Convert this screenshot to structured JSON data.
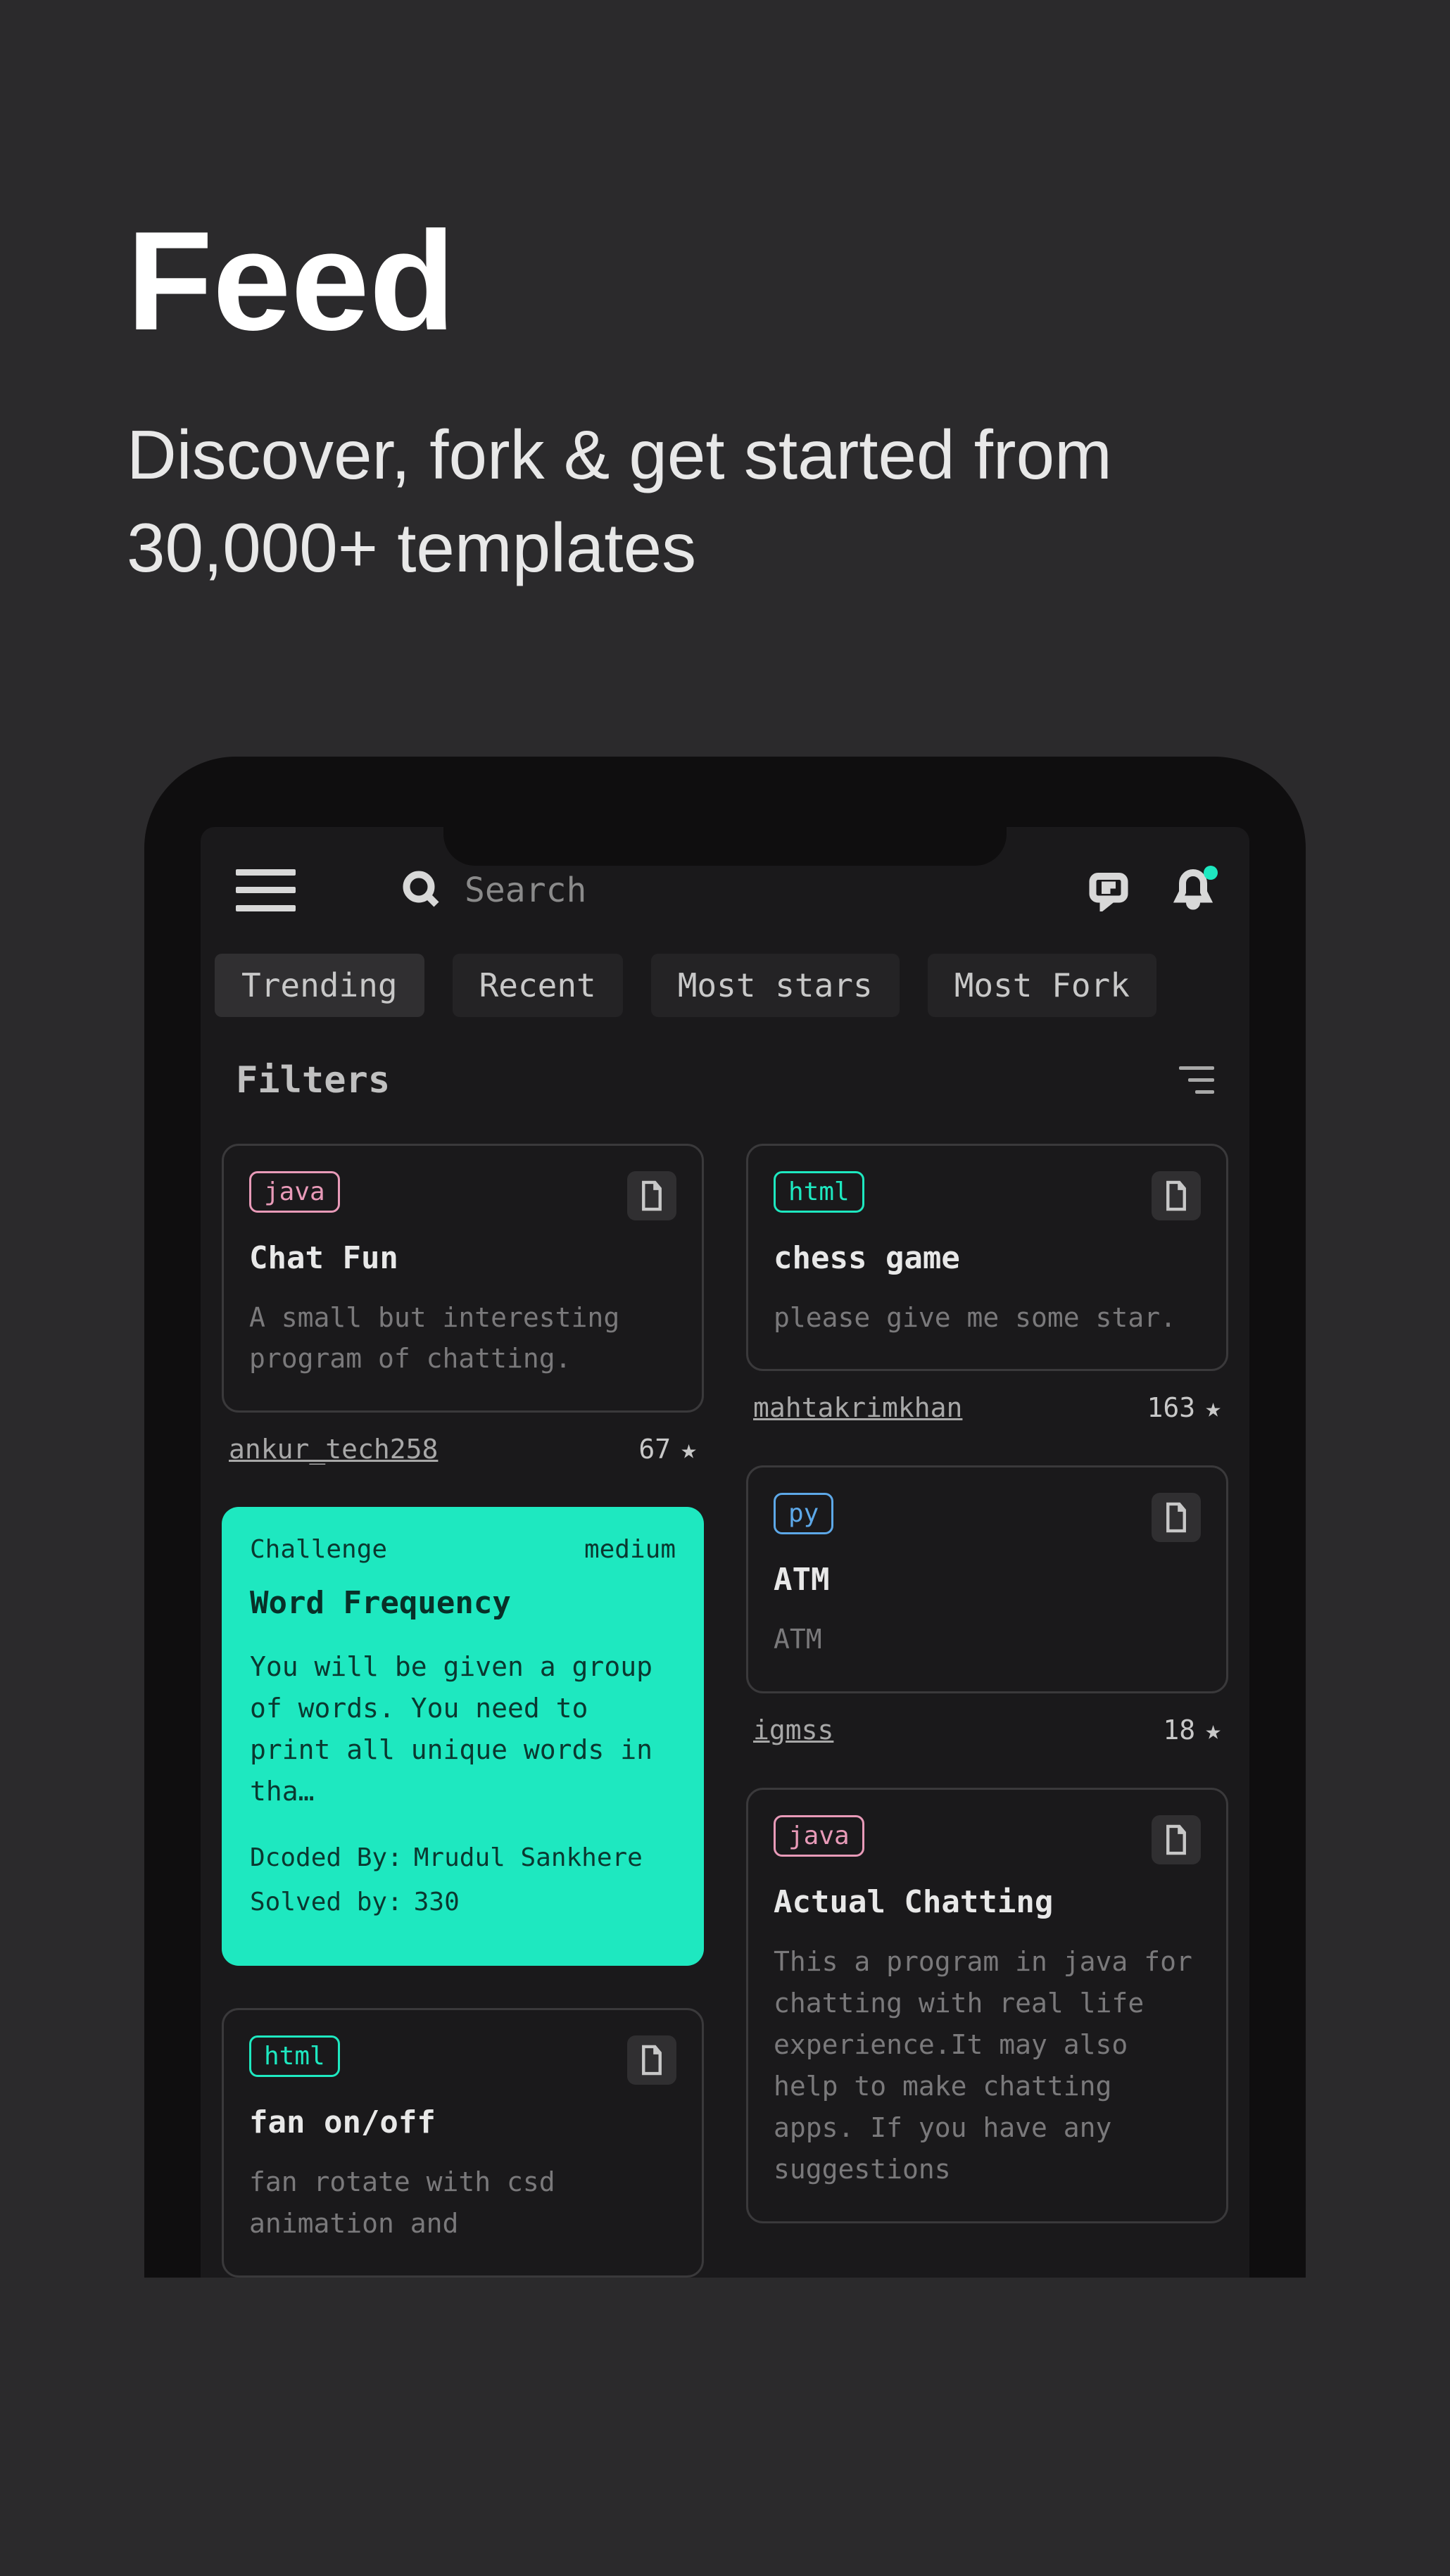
{
  "promo": {
    "title": "Feed",
    "subtitle": "Discover, fork & get started from 30,000+ templates"
  },
  "search": {
    "placeholder": "Search"
  },
  "tabs": [
    {
      "label": "Trending",
      "active": true
    },
    {
      "label": "Recent",
      "active": false
    },
    {
      "label": "Most stars",
      "active": false
    },
    {
      "label": "Most Fork",
      "active": false
    }
  ],
  "filters": {
    "label": "Filters"
  },
  "cards": {
    "chat_fun": {
      "lang": "java",
      "title": "Chat Fun",
      "desc": "A small but interesting program of chatting.",
      "author": "ankur_tech258",
      "stars": "67"
    },
    "chess": {
      "lang": "html",
      "title": "chess game",
      "desc": "please give me some star.",
      "author": "mahtakrimkhan",
      "stars": "163"
    },
    "challenge": {
      "badge": "Challenge",
      "difficulty": "medium",
      "title": "Word Frequency",
      "desc": "You will be given a group of words. You need to print all unique words in tha…",
      "decoded_label": "Dcoded By:",
      "decoded_by": "Mrudul Sankhere",
      "solved_label": "Solved by:",
      "solved_by": "330"
    },
    "atm": {
      "lang": "py",
      "title": "ATM",
      "desc": "ATM",
      "author": "igmss",
      "stars": "18"
    },
    "fan": {
      "lang": "html",
      "title": "fan on/off",
      "desc": "fan rotate with csd animation and"
    },
    "actual_chatting": {
      "lang": "java",
      "title": "Actual Chatting",
      "desc": "This a program in java for chatting with real life experience.It may also help to make chatting apps. If you have any suggestions"
    }
  }
}
